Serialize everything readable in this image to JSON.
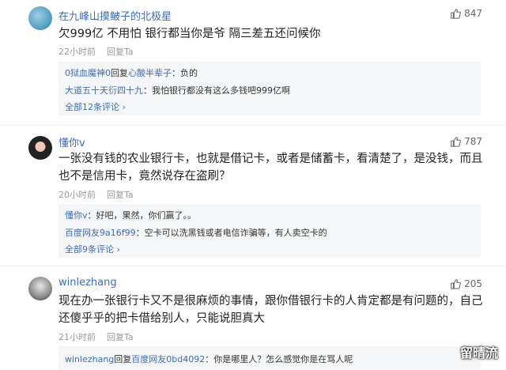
{
  "comments": [
    {
      "username": "在九峰山摸鲏子的北极星",
      "likes": "847",
      "text": "欠999亿 不用怕 银行都当你是爷 隔三差五还问候你",
      "time": "22小时前",
      "reply_label": "回复Ta",
      "replies": [
        {
          "user": "0狱血魔神0",
          "mid": "回复",
          "target": "心酸半辈子",
          "text": "：负的"
        },
        {
          "user": "大道五十天衍四十九",
          "mid": "",
          "target": "",
          "text": "：我怕银行都没有这么多钱吧999亿啊"
        }
      ],
      "more": "全部12条评论 ›"
    },
    {
      "username": "懂你v",
      "likes": "787",
      "text": "一张没有钱的农业银行卡，也就是借记卡，或者是储蓄卡，看清楚了，是没钱，而且也不是信用卡，竟然说存在盗刷？",
      "time": "20小时前",
      "reply_label": "回复Ta",
      "replies": [
        {
          "user": "懂你v",
          "mid": "",
          "target": "",
          "text": "：好吧，果然，你们赢了。。"
        },
        {
          "user": "百度网友9a16f99",
          "mid": "",
          "target": "",
          "text": "：空卡可以洗黑钱或者电信诈骗等，有人卖空卡的"
        }
      ],
      "more": "全部9条评论 ›"
    },
    {
      "username": "winlezhang",
      "likes": "205",
      "text": "现在办一张银行卡又不是很麻烦的事情，跟你借银行卡的人肯定都是有问题的，自己还傻乎乎的把卡借给别人，只能说胆真大",
      "time": "21小时前",
      "reply_label": "回复Ta",
      "replies": [
        {
          "user": "winlezhang",
          "mid": "回复",
          "target": "百度网友0bd4092",
          "text": "：你是哪里人？怎么感觉你是在骂人呢"
        }
      ],
      "more": ""
    }
  ],
  "watermark": "留晴流",
  "colors": {
    "link": "#3b6cbf",
    "meta": "#999999",
    "reply_bg": "#f5f6f7"
  },
  "icons": {
    "like": "thumbs-up-icon",
    "more": "chevron-right-icon"
  }
}
